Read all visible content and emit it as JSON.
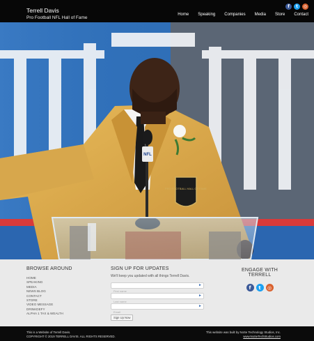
{
  "header": {
    "name": "Terrell Davis",
    "subtitle": "Pro Football NFL Hall of Fame",
    "nav": [
      "Home",
      "Speaking",
      "Companies",
      "Media",
      "Store",
      "Contact"
    ],
    "social": [
      {
        "icon": "facebook-icon",
        "glyph": "f"
      },
      {
        "icon": "twitter-icon",
        "glyph": "t"
      },
      {
        "icon": "instagram-icon",
        "glyph": "◎"
      }
    ]
  },
  "hero": {
    "podium_text": "NFL",
    "badge_text": "PRO FOOTBALL HALL OF FAME"
  },
  "browse": {
    "title": "BROWSE AROUND",
    "links": [
      "HOME",
      "SPEAKING",
      "MEDIA",
      "NEWS BLOG",
      "CONTACT",
      "STORE",
      "VIDEO MESSAGE",
      "DRINKDEFY",
      "ALPHA 1 TAX & WEALTH"
    ]
  },
  "signup": {
    "title": "SIGN UP FOR UPDATES",
    "description": "We'll keep you updated with all things Terrell Davis.",
    "fields": [
      {
        "placeholder": "First name"
      },
      {
        "placeholder": "Last name"
      },
      {
        "placeholder": "Email"
      }
    ],
    "button": "Sign Up Now"
  },
  "engage": {
    "title": "ENGAGE WITH TERRELL"
  },
  "copyright": {
    "line1": "This is a Website of Terrell Davis.",
    "line2": "COPYRIGHT © 2019 TERRELL DAVIS. ALL RIGHTS RESERVED.",
    "credit1": "This website was built by NoSe Technology Studios, Inc.",
    "credit2": "www.NoSeTechStudios.com"
  },
  "colors": {
    "facebook": "#3b5998",
    "twitter": "#1da1f2",
    "instagram": "#d9612e",
    "jacket": "#d9a848",
    "hero_blue": "#2f6fb8"
  }
}
